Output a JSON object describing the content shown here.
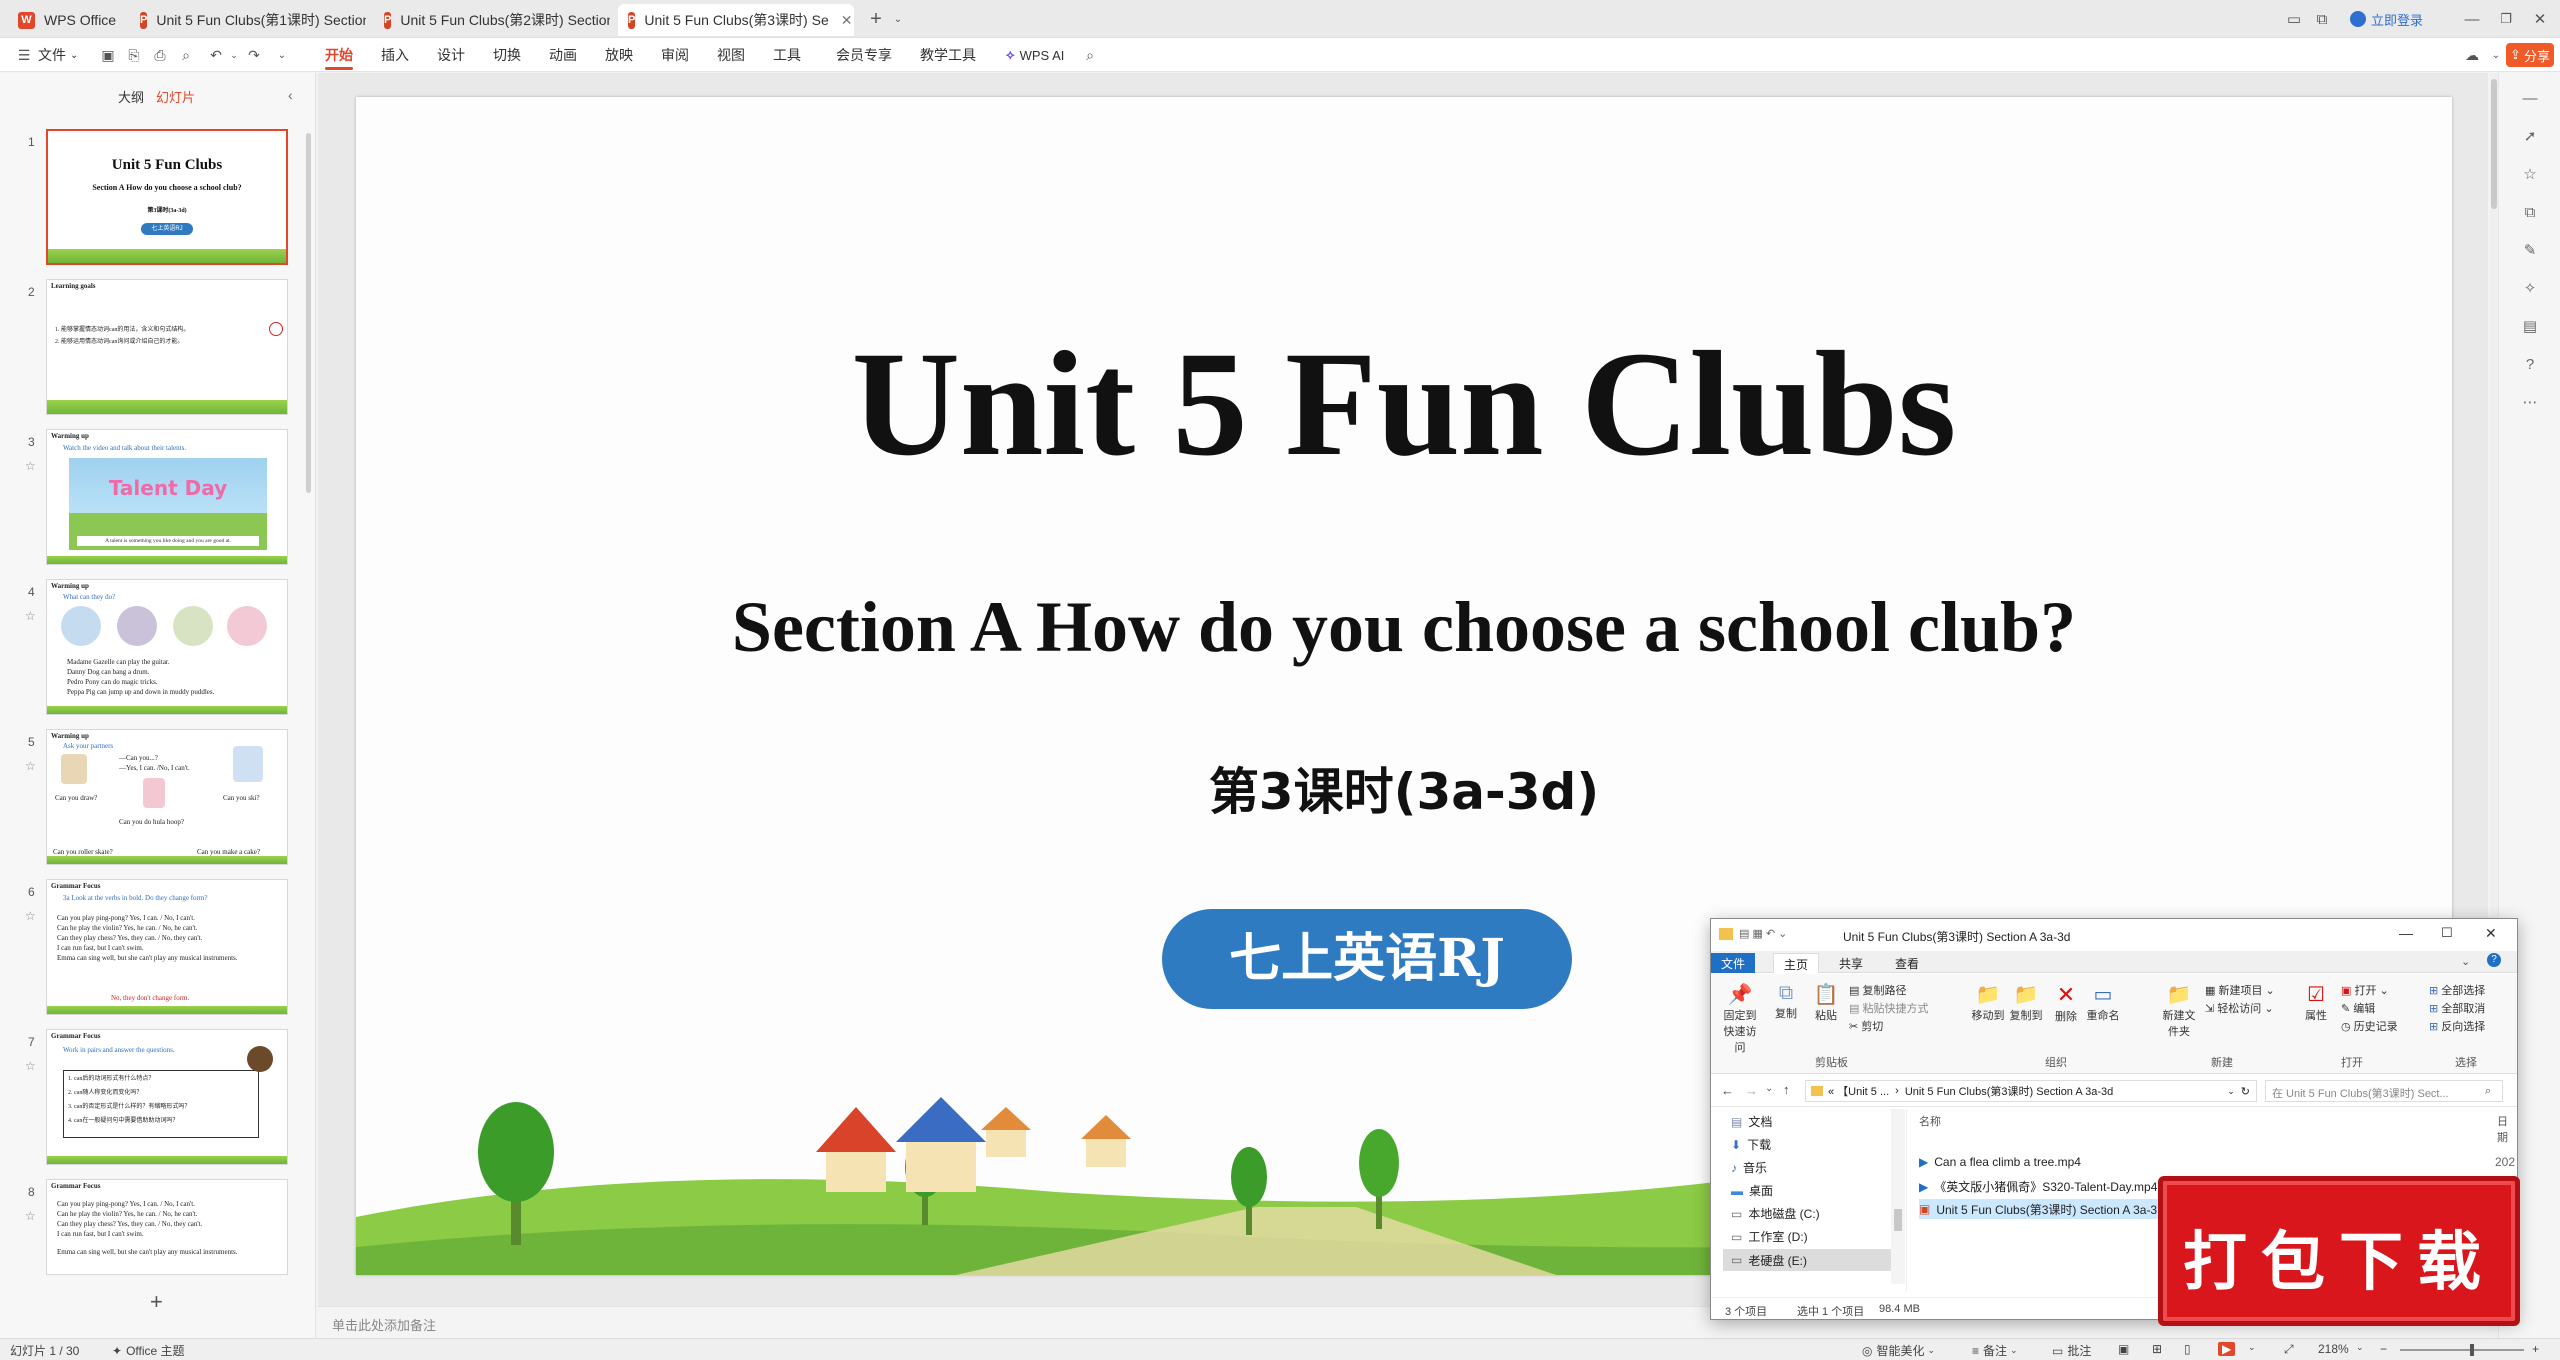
{
  "tabs": {
    "app": "WPS Office",
    "doc1": "Unit 5 Fun Clubs(第1课时) Section A",
    "doc2": "Unit 5 Fun Clubs(第2课时) Section A",
    "doc3": "Unit 5 Fun Clubs(第3课时) Se",
    "add": "+",
    "login": "立即登录"
  },
  "menu": {
    "file": "文件",
    "items": [
      "开始",
      "插入",
      "设计",
      "切换",
      "动画",
      "放映",
      "审阅",
      "视图",
      "工具",
      "会员专享",
      "教学工具"
    ],
    "ai": "WPS AI",
    "share": "分享"
  },
  "outline_tabs": {
    "outline": "大纲",
    "slides": "幻灯片"
  },
  "thumbs": {
    "s1": {
      "title": "Unit 5 Fun Clubs",
      "sub": "Section A How do you choose a school club?",
      "lesson": "第3课时(3a-3d)",
      "badge": "七上英语RJ"
    },
    "s2": {
      "head": "Learning goals",
      "l1": "1. 能够掌握情态动词can的用法，含义和句式结构。",
      "l2": "2. 能够运用情态动词can询问或介绍自己的才能。"
    },
    "s3": {
      "head": "Warming up",
      "line": "Watch the video and talk about their talents.",
      "banner": "Talent Day",
      "caption": "A talent is something you like doing and you are good at."
    },
    "s4": {
      "head": "Warming up",
      "q": "What can they do?",
      "a1": "Madame Gazelle can play the guitar.",
      "a2": "Danny Dog can bang a drum.",
      "a3": "Pedro Pony can do magic tricks.",
      "a4": "Peppa Pig can jump up and down in muddy puddles."
    },
    "s5": {
      "head": "Warming up",
      "q": "Ask your partners",
      "d1": "—Can you...?",
      "d2": "—Yes, I can. /No, I can't.",
      "c1": "Can you draw?",
      "c2": "Can you ski?",
      "c3": "Can you do hula hoop?",
      "c4": "Can you roller skate?",
      "c5": "Can you make a cake?"
    },
    "s6": {
      "head": "Grammar Focus",
      "q": "3a  Look at the verbs in bold. Do they change form?",
      "l1": "Can you play ping-pong?   Yes, I can. / No, I can't.",
      "l2": "Can he play the violin?     Yes, he can. / No, he can't.",
      "l3": "Can they play chess?        Yes, they can. / No, they can't.",
      "l4": "I can run fast, but I can't swim.",
      "l5": "Emma can sing well, but she can't play any musical instruments.",
      "red": "No, they don't change form."
    },
    "s7": {
      "head": "Grammar Focus",
      "q": "Work in pairs and answer the questions.",
      "l1": "1. can后的动词形式有什么特点？",
      "l2": "2. can随人称变化而变化吗？",
      "l3": "3. can的否定形式是什么样的？有缩略形式吗？",
      "l4": "4. can在一般疑问句中需要借助助动词吗？"
    },
    "s8": {
      "head": "Grammar Focus",
      "l1": "Can you play ping-pong?   Yes, I can. / No, I can't.",
      "l2": "Can he play the violin?     Yes, he can. / No, he can't.",
      "l3": "Can they play chess?        Yes, they can. / No, they can't.",
      "l4": "I can run fast, but I can't swim.",
      "l5": "Emma can sing well, but she can't play any musical instruments."
    },
    "nums": [
      "1",
      "2",
      "3",
      "4",
      "5",
      "6",
      "7",
      "8"
    ],
    "add": "+"
  },
  "slide": {
    "title": "Unit 5 Fun Clubs",
    "subtitle": "Section A How do you choose a school club?",
    "lesson": "第3课时(3a-3d)",
    "badge": "七上英语RJ"
  },
  "notes_placeholder": "单击此处添加备注",
  "status": {
    "slide_info": "幻灯片 1 / 30",
    "theme": "Office 主题",
    "beautify": "智能美化",
    "notes": "备注",
    "comments": "批注",
    "zoom": "218%"
  },
  "explorer": {
    "title": "Unit 5 Fun Clubs(第3课时) Section A 3a-3d",
    "tabs": {
      "file": "文件",
      "home": "主页",
      "share": "共享",
      "view": "查看"
    },
    "tools": {
      "pin": "固定到快速访问",
      "copy": "复制",
      "paste": "粘贴",
      "copy_path": "复制路径",
      "paste_shortcut": "粘贴快捷方式",
      "cut": "剪切",
      "move_to": "移动到",
      "copy_to": "复制到",
      "delete": "删除",
      "rename": "重命名",
      "new_folder": "新建文件夹",
      "new_item": "新建项目",
      "easy_access": "轻松访问",
      "properties": "属性",
      "open": "打开",
      "edit": "编辑",
      "history": "历史记录",
      "select_all": "全部选择",
      "select_none": "全部取消",
      "invert": "反向选择"
    },
    "groups": {
      "clipboard": "剪贴板",
      "organize": "组织",
      "new": "新建",
      "open": "打开",
      "select": "选择"
    },
    "path_crumb1": "« 【Unit 5 ...",
    "path_crumb2": "Unit 5 Fun Clubs(第3课时) Section A 3a-3d",
    "search_placeholder": "在 Unit 5 Fun Clubs(第3课时) Sect...",
    "tree": [
      "文档",
      "下载",
      "音乐",
      "桌面",
      "本地磁盘 (C:)",
      "工作室 (D:)",
      "老硬盘 (E:)"
    ],
    "col_name": "名称",
    "col_date": "日期",
    "files": [
      {
        "name": "Can a flea climb a tree.mp4",
        "date": "202"
      },
      {
        "name": "《英文版小猪佩奇》S320-Talent-Day.mp4",
        "date": "202"
      },
      {
        "name": "Unit 5 Fun Clubs(第3课时) Section A 3a-3",
        "date": "202"
      }
    ],
    "status_count": "3 个项目",
    "status_selected": "选中 1 个项目",
    "status_size": "98.4 MB"
  },
  "stamp": "打包下载",
  "colors": {
    "accent": "#e2472b",
    "badge": "#2f7bc2",
    "stamp": "#d9161c"
  }
}
